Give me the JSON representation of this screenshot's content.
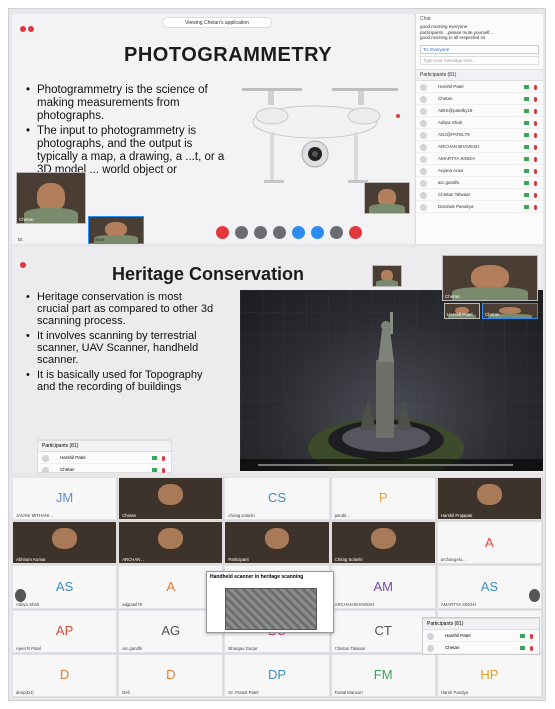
{
  "panel1": {
    "viewing_text": "Viewing Chetan's application",
    "title": "PHOTOGRAMMETRY",
    "bullets": [
      "Photogrammetry is the science of making measurements from photographs.",
      "The input to photogrammetry is photographs, and the output is typically a map, a drawing, a ...t, or a 3D model ... world object or"
    ],
    "tile_names": [
      "Chetan",
      "Dr.",
      "Chetan"
    ],
    "chat": {
      "header": "Chat",
      "messages": [
        "good morning everyone",
        "participants ...please mute yourself...",
        "good morning to all respected sir"
      ],
      "to_label": "To:",
      "to_value": "Everyone",
      "placeholder": "Type your message here..."
    },
    "participants": {
      "header": "Participants (81)",
      "rows": [
        "Harshil Patel",
        "Chetan",
        "ABHI@patelky19",
        "Aditya Shah",
        "ADJ@PATEL79",
        "ARCHAN BHAVESH",
        "AMARTYA SINGH",
        "Anjana Aravi",
        "arc.gandhi",
        "Chintan Talwaar",
        "Darshak Panakya"
      ]
    },
    "ctrl_colors": [
      "#e0383e",
      "#6b6b74",
      "#6b6b74",
      "#6b6b74",
      "#2d8cf0",
      "#2d8cf0",
      "#6b6b74",
      "#e0383e"
    ]
  },
  "panel2": {
    "title": "Heritage Conservation",
    "bullets": [
      "Heritage conservation is most crucial part as compared to other 3d scanning process.",
      "It involves scanning by terrestrial scanner, UAV Scanner, handheld scanner.",
      "It is basically used for Topography and the recording of buildings"
    ],
    "tile_names": [
      "Chetan",
      "Harshil Patel",
      "Chetan"
    ],
    "participants": {
      "header": "Participants (81)",
      "rows": [
        "Harshil Patel",
        "Chetan"
      ]
    }
  },
  "panel3": {
    "cells": [
      {
        "initials": "JM",
        "color": "#5a8fd0",
        "name": "JAVANI MITHANI..."
      },
      {
        "initials": "",
        "color": "",
        "name": "Chetan"
      },
      {
        "initials": "CS",
        "color": "#3d8fc4",
        "name": "chirag solanki"
      },
      {
        "initials": "P",
        "color": "#e1a23b",
        "name": "pandit..."
      },
      {
        "initials": "",
        "color": "",
        "name": "Harshil Prajapati"
      },
      {
        "initials": "",
        "color": "",
        "name": "Abhiram Kumar"
      },
      {
        "initials": "",
        "color": "",
        "name": "ARCHAN..."
      },
      {
        "initials": "",
        "color": "",
        "name": "Participant"
      },
      {
        "initials": "",
        "color": "",
        "name": "Chirag Solanki"
      },
      {
        "initials": "A",
        "color": "#e2453a",
        "name": "archangelo..."
      },
      {
        "initials": "AS",
        "color": "#3d8fc4",
        "name": "Aditya Shah"
      },
      {
        "initials": "A",
        "color": "#e27b2b",
        "name": "adjpatel79"
      },
      {
        "initials": "",
        "color": "",
        "name": ""
      },
      {
        "initials": "AM",
        "color": "#7b4aa6",
        "name": "ARCHAN BHAVESH"
      },
      {
        "initials": "AS",
        "color": "#3d8fc4",
        "name": "AMARTYA SINGH"
      },
      {
        "initials": "AP",
        "color": "#e2453a",
        "name": "Ajeet R Patel"
      },
      {
        "initials": "AG",
        "color": "#555555",
        "name": "arc.gandhi"
      },
      {
        "initials": "BC",
        "color": "#c94a8a",
        "name": "Bhargav Gurjar"
      },
      {
        "initials": "CT",
        "color": "#555555",
        "name": "Chintan Talwaar"
      },
      {
        "initials": "",
        "color": "",
        "name": ""
      },
      {
        "initials": "D",
        "color": "#e27b2b",
        "name": "deep(DJ)"
      },
      {
        "initials": "D",
        "color": "#e27b2b",
        "name": "Dell"
      },
      {
        "initials": "DP",
        "color": "#3d8fc4",
        "name": "Dr. Pramit Patel"
      },
      {
        "initials": "FM",
        "color": "#3aa45c",
        "name": "Faisal Mansuri"
      },
      {
        "initials": "HP",
        "color": "#d9a228",
        "name": "Harsh Pandya"
      }
    ],
    "shared_title": "Handheld scanner in heritage scanning",
    "participants": {
      "header": "Participants (81)",
      "rows": [
        "Harshil Patel",
        "Chetan"
      ]
    }
  }
}
